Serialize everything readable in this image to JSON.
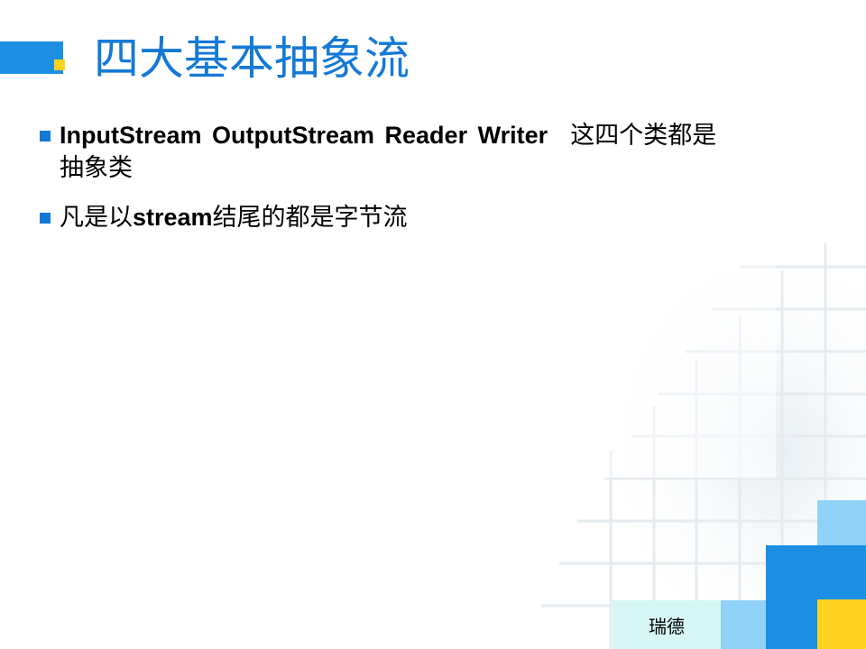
{
  "title": "四大基本抽象流",
  "bullets": [
    {
      "text_en": "InputStream OutputStream  Reader  Writer",
      "text_cn_1": "这四个类都是",
      "text_cn_2": "抽象类"
    },
    {
      "text_cn_pre": "凡是以",
      "text_en": "stream",
      "text_cn_post": "结尾的都是字节流"
    }
  ],
  "footer": {
    "label": "瑞德"
  },
  "colors": {
    "accent_blue": "#1479d6",
    "accent_yellow": "#ffd21f",
    "light_blue": "#8fd1f7",
    "bright_blue": "#1c8fe3",
    "pale_cyan": "#d5f6f4"
  }
}
